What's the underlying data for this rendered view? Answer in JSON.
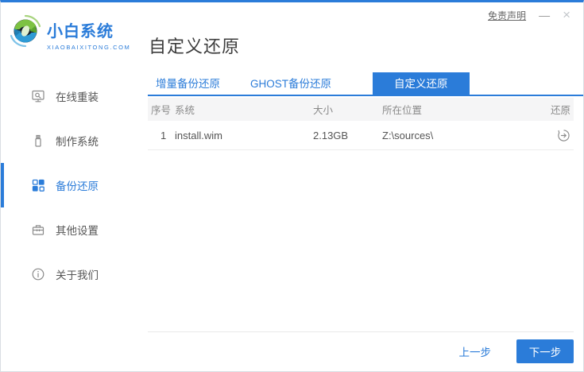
{
  "window": {
    "disclaimer": "免责声明",
    "minimize": "—",
    "close": "×"
  },
  "brand": {
    "name": "小白系统",
    "domain": "XIAOBAIXITONG.COM"
  },
  "page": {
    "title": "自定义还原"
  },
  "sidebar": {
    "items": [
      {
        "label": "在线重装",
        "icon": "monitor-reinstall-icon",
        "active": false
      },
      {
        "label": "制作系统",
        "icon": "usb-drive-icon",
        "active": false
      },
      {
        "label": "备份还原",
        "icon": "tiles-grid-icon",
        "active": true
      },
      {
        "label": "其他设置",
        "icon": "toolbox-icon",
        "active": false
      },
      {
        "label": "关于我们",
        "icon": "info-circle-icon",
        "active": false
      }
    ]
  },
  "tabs": [
    {
      "label": "增量备份还原",
      "active": false
    },
    {
      "label": "GHOST备份还原",
      "active": false
    },
    {
      "label": "自定义还原",
      "active": true
    }
  ],
  "table": {
    "headers": [
      "序号",
      "系统",
      "大小",
      "所在位置",
      "还原"
    ],
    "rows": [
      {
        "index": "1",
        "system": "install.wim",
        "size": "2.13GB",
        "location": "Z:\\sources\\",
        "action_icon": "restore-history-icon"
      }
    ]
  },
  "footer": {
    "prev_label": "上一步",
    "next_label": "下一步"
  },
  "colors": {
    "accent": "#2B7CD9",
    "header_row_bg": "#f5f5f6",
    "logo_green": "#7dc242",
    "logo_blue": "#2e9bd6",
    "logo_dark": "#17222e"
  }
}
